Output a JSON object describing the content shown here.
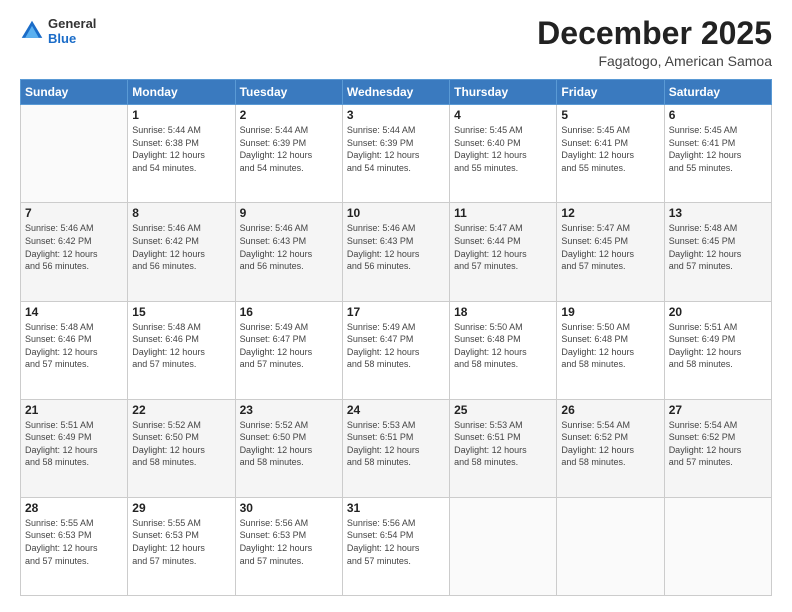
{
  "header": {
    "logo_general": "General",
    "logo_blue": "Blue",
    "month_title": "December 2025",
    "location": "Fagatogo, American Samoa"
  },
  "calendar": {
    "days_of_week": [
      "Sunday",
      "Monday",
      "Tuesday",
      "Wednesday",
      "Thursday",
      "Friday",
      "Saturday"
    ],
    "weeks": [
      [
        {
          "day": "",
          "info": ""
        },
        {
          "day": "1",
          "info": "Sunrise: 5:44 AM\nSunset: 6:38 PM\nDaylight: 12 hours\nand 54 minutes."
        },
        {
          "day": "2",
          "info": "Sunrise: 5:44 AM\nSunset: 6:39 PM\nDaylight: 12 hours\nand 54 minutes."
        },
        {
          "day": "3",
          "info": "Sunrise: 5:44 AM\nSunset: 6:39 PM\nDaylight: 12 hours\nand 54 minutes."
        },
        {
          "day": "4",
          "info": "Sunrise: 5:45 AM\nSunset: 6:40 PM\nDaylight: 12 hours\nand 55 minutes."
        },
        {
          "day": "5",
          "info": "Sunrise: 5:45 AM\nSunset: 6:41 PM\nDaylight: 12 hours\nand 55 minutes."
        },
        {
          "day": "6",
          "info": "Sunrise: 5:45 AM\nSunset: 6:41 PM\nDaylight: 12 hours\nand 55 minutes."
        }
      ],
      [
        {
          "day": "7",
          "info": "Sunrise: 5:46 AM\nSunset: 6:42 PM\nDaylight: 12 hours\nand 56 minutes."
        },
        {
          "day": "8",
          "info": "Sunrise: 5:46 AM\nSunset: 6:42 PM\nDaylight: 12 hours\nand 56 minutes."
        },
        {
          "day": "9",
          "info": "Sunrise: 5:46 AM\nSunset: 6:43 PM\nDaylight: 12 hours\nand 56 minutes."
        },
        {
          "day": "10",
          "info": "Sunrise: 5:46 AM\nSunset: 6:43 PM\nDaylight: 12 hours\nand 56 minutes."
        },
        {
          "day": "11",
          "info": "Sunrise: 5:47 AM\nSunset: 6:44 PM\nDaylight: 12 hours\nand 57 minutes."
        },
        {
          "day": "12",
          "info": "Sunrise: 5:47 AM\nSunset: 6:45 PM\nDaylight: 12 hours\nand 57 minutes."
        },
        {
          "day": "13",
          "info": "Sunrise: 5:48 AM\nSunset: 6:45 PM\nDaylight: 12 hours\nand 57 minutes."
        }
      ],
      [
        {
          "day": "14",
          "info": "Sunrise: 5:48 AM\nSunset: 6:46 PM\nDaylight: 12 hours\nand 57 minutes."
        },
        {
          "day": "15",
          "info": "Sunrise: 5:48 AM\nSunset: 6:46 PM\nDaylight: 12 hours\nand 57 minutes."
        },
        {
          "day": "16",
          "info": "Sunrise: 5:49 AM\nSunset: 6:47 PM\nDaylight: 12 hours\nand 57 minutes."
        },
        {
          "day": "17",
          "info": "Sunrise: 5:49 AM\nSunset: 6:47 PM\nDaylight: 12 hours\nand 58 minutes."
        },
        {
          "day": "18",
          "info": "Sunrise: 5:50 AM\nSunset: 6:48 PM\nDaylight: 12 hours\nand 58 minutes."
        },
        {
          "day": "19",
          "info": "Sunrise: 5:50 AM\nSunset: 6:48 PM\nDaylight: 12 hours\nand 58 minutes."
        },
        {
          "day": "20",
          "info": "Sunrise: 5:51 AM\nSunset: 6:49 PM\nDaylight: 12 hours\nand 58 minutes."
        }
      ],
      [
        {
          "day": "21",
          "info": "Sunrise: 5:51 AM\nSunset: 6:49 PM\nDaylight: 12 hours\nand 58 minutes."
        },
        {
          "day": "22",
          "info": "Sunrise: 5:52 AM\nSunset: 6:50 PM\nDaylight: 12 hours\nand 58 minutes."
        },
        {
          "day": "23",
          "info": "Sunrise: 5:52 AM\nSunset: 6:50 PM\nDaylight: 12 hours\nand 58 minutes."
        },
        {
          "day": "24",
          "info": "Sunrise: 5:53 AM\nSunset: 6:51 PM\nDaylight: 12 hours\nand 58 minutes."
        },
        {
          "day": "25",
          "info": "Sunrise: 5:53 AM\nSunset: 6:51 PM\nDaylight: 12 hours\nand 58 minutes."
        },
        {
          "day": "26",
          "info": "Sunrise: 5:54 AM\nSunset: 6:52 PM\nDaylight: 12 hours\nand 58 minutes."
        },
        {
          "day": "27",
          "info": "Sunrise: 5:54 AM\nSunset: 6:52 PM\nDaylight: 12 hours\nand 57 minutes."
        }
      ],
      [
        {
          "day": "28",
          "info": "Sunrise: 5:55 AM\nSunset: 6:53 PM\nDaylight: 12 hours\nand 57 minutes."
        },
        {
          "day": "29",
          "info": "Sunrise: 5:55 AM\nSunset: 6:53 PM\nDaylight: 12 hours\nand 57 minutes."
        },
        {
          "day": "30",
          "info": "Sunrise: 5:56 AM\nSunset: 6:53 PM\nDaylight: 12 hours\nand 57 minutes."
        },
        {
          "day": "31",
          "info": "Sunrise: 5:56 AM\nSunset: 6:54 PM\nDaylight: 12 hours\nand 57 minutes."
        },
        {
          "day": "",
          "info": ""
        },
        {
          "day": "",
          "info": ""
        },
        {
          "day": "",
          "info": ""
        }
      ]
    ]
  }
}
